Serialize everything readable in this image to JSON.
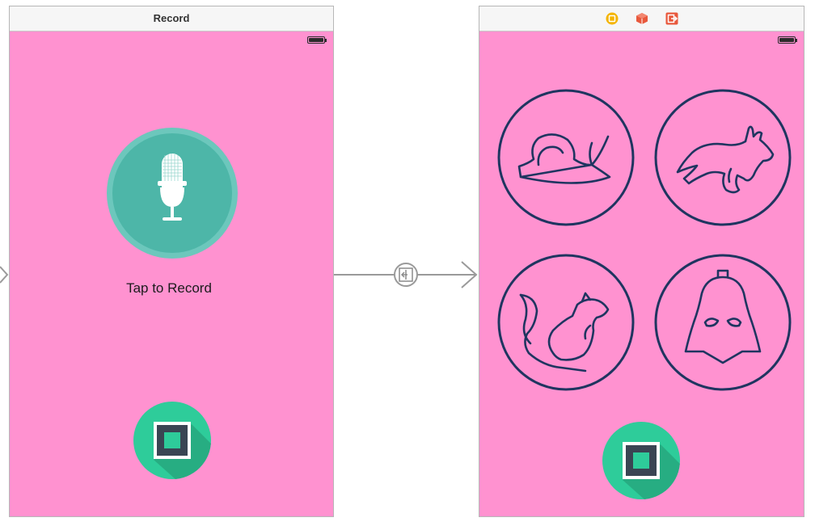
{
  "record_scene": {
    "title": "Record",
    "caption": "Tap to Record"
  },
  "play_scene": {
    "toolbar_icons": [
      "view-controller-icon",
      "first-responder-icon",
      "exit-icon"
    ],
    "sound_buttons": [
      "snail-icon",
      "rabbit-icon",
      "squirrel-icon",
      "darth-vader-icon"
    ]
  },
  "segue": {
    "icon": "segue-show-icon"
  },
  "colors": {
    "scene_background": "#ff92d0",
    "accent_teal": "#2ecc9a",
    "mic_teal": "#4db6a8",
    "icon_navy": "#1f3560"
  }
}
